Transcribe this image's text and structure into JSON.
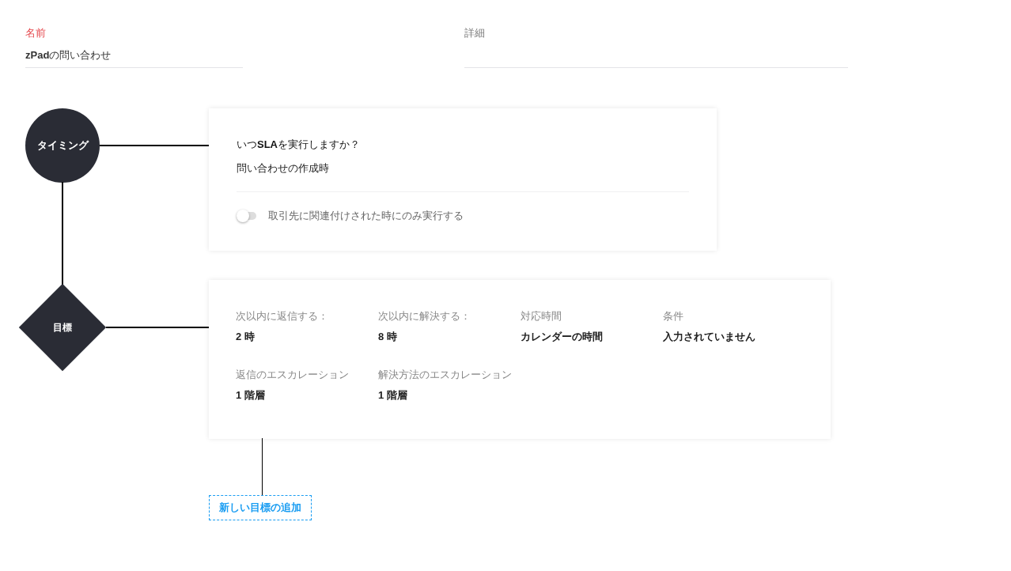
{
  "fields": [
    {
      "label": "名前",
      "value": "**zPad**の問い合わせ",
      "required": true
    },
    {
      "label": "詳細",
      "required": false
    }
  ],
  "timing": {
    "node": "タイミング",
    "question": "いつ**SLA**を実行しますか？",
    "answer": "問い合わせの作成時",
    "toggle": {
      "label": "取引先に関連付けされた時にのみ実行する",
      "on": false
    }
  },
  "goal": {
    "node": "目標",
    "items": [
      {
        "label": "次以内に返信する：",
        "value": "2 **時**"
      },
      {
        "label": "次以内に解決する：",
        "value": "8 **時**"
      },
      {
        "label": "対応時間",
        "value": "カレンダーの時間"
      },
      {
        "label": "条件",
        "value": "入力されていません"
      },
      {
        "label": "返信のエスカレーション",
        "value": "1 階層"
      },
      {
        "label": "解決方法のエスカレーション",
        "value": "1 階層"
      }
    ]
  },
  "add_goal_button": "新しい目標の追加"
}
